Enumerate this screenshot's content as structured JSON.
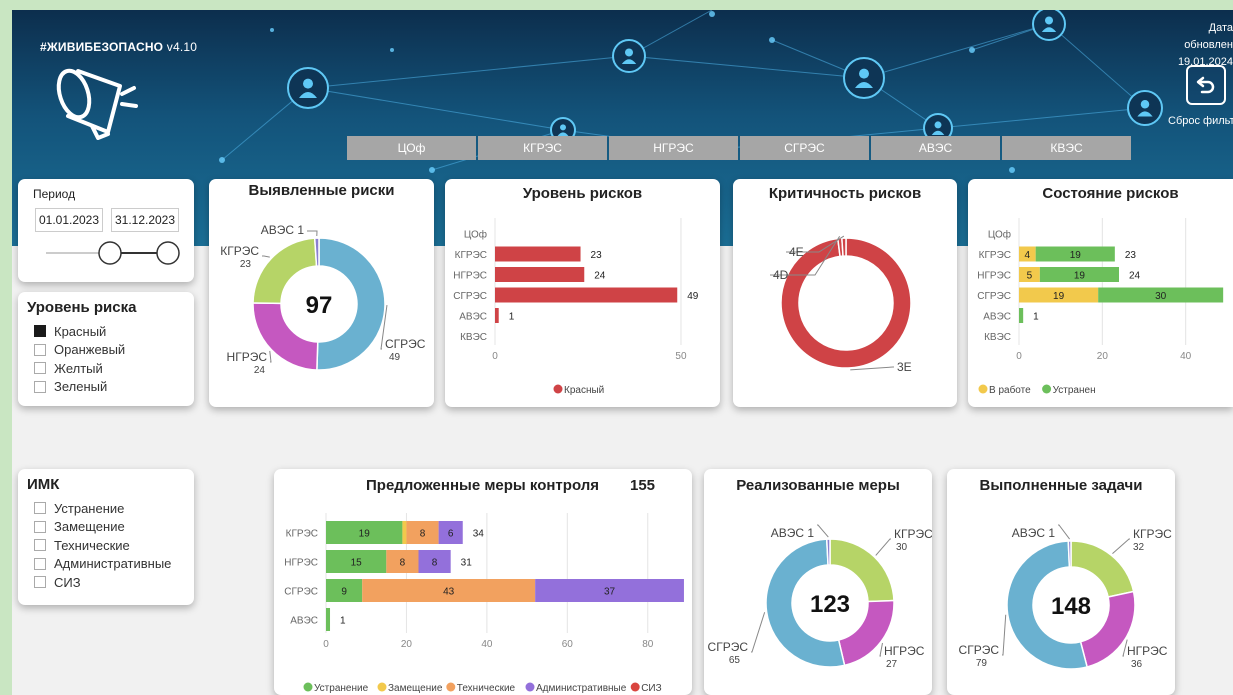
{
  "brand": {
    "name": "#ЖИВИБЕЗОПАСНО",
    "version": "v4.10"
  },
  "updated": {
    "label": "Дата обновлен",
    "date": "19.01.2024"
  },
  "reset": {
    "label": "Сброс фильтр"
  },
  "tabs": [
    "ЦОф",
    "КГРЭС",
    "НГРЭС",
    "СГРЭС",
    "АВЭС",
    "КВЭС"
  ],
  "period": {
    "label": "Период",
    "from": "01.01.2023",
    "to": "31.12.2023"
  },
  "risk_level_filter": {
    "title": "Уровень риска",
    "options": [
      {
        "label": "Красный",
        "checked": true
      },
      {
        "label": "Оранжевый",
        "checked": false
      },
      {
        "label": "Желтый",
        "checked": false
      },
      {
        "label": "Зеленый",
        "checked": false
      }
    ]
  },
  "imk_filter": {
    "title": "ИМК",
    "options": [
      {
        "label": "Устранение",
        "checked": false
      },
      {
        "label": "Замещение",
        "checked": false
      },
      {
        "label": "Технические",
        "checked": false
      },
      {
        "label": "Административные",
        "checked": false
      },
      {
        "label": "СИЗ",
        "checked": false
      }
    ]
  },
  "colors": {
    "blue": "#6ab1d0",
    "green": "#b6d467",
    "purple": "#c558c0",
    "red": "#cf4346",
    "meas_green": "#6cbf5b",
    "meas_yellow": "#f2c94c",
    "meas_orange": "#f2a15f",
    "meas_purple": "#9370db",
    "meas_red": "#d9453f"
  },
  "chart_data": [
    {
      "id": "identified",
      "type": "pie",
      "title": "Выявленные риски",
      "center_value": "97",
      "slices": [
        {
          "label": "СГРЭС",
          "value": 49,
          "color": "#6ab1d0"
        },
        {
          "label": "НГРЭС",
          "value": 24,
          "color": "#c558c0"
        },
        {
          "label": "КГРЭС",
          "value": 23,
          "color": "#b6d467"
        },
        {
          "label": "АВЭС",
          "value": 1,
          "color": "#8a7fd0"
        }
      ]
    },
    {
      "id": "risk_level",
      "type": "bar",
      "title": "Уровень рисков",
      "categories": [
        "ЦОф",
        "КГРЭС",
        "НГРЭС",
        "СГРЭС",
        "АВЭС",
        "КВЭС"
      ],
      "series": [
        {
          "name": "Красный",
          "values": [
            null,
            23,
            24,
            49,
            1,
            null
          ],
          "color": "#cf4346"
        }
      ],
      "xticks": [
        "0",
        "50"
      ],
      "xlim": [
        0,
        57
      ]
    },
    {
      "id": "criticality",
      "type": "pie",
      "title": "Критичность рисков",
      "slices": [
        {
          "label": "3E",
          "value": 97,
          "color": "#cf4346"
        },
        {
          "label": "4D",
          "value": 1,
          "color": "#cf4346"
        },
        {
          "label": "4E",
          "value": 1,
          "color": "#cf4346"
        }
      ]
    },
    {
      "id": "risk_state",
      "type": "bar",
      "title": "Состояние рисков",
      "categories": [
        "ЦОф",
        "КГРЭС",
        "НГРЭС",
        "СГРЭС",
        "АВЭС",
        "КВЭС"
      ],
      "series": [
        {
          "name": "В работе",
          "values": [
            null,
            4,
            5,
            19,
            null,
            null
          ],
          "color": "#f2c94c"
        },
        {
          "name": "Устранен",
          "values": [
            null,
            19,
            19,
            30,
            1,
            null
          ],
          "color": "#6cbf5b"
        }
      ],
      "totals": [
        null,
        23,
        24,
        49,
        null,
        null
      ],
      "xticks": [
        "0",
        "20",
        "40"
      ],
      "xlim": [
        0,
        48
      ]
    },
    {
      "id": "proposed",
      "type": "bar",
      "title": "Предложенные меры контроля",
      "total": "155",
      "categories": [
        "КГРЭС",
        "НГРЭС",
        "СГРЭС",
        "АВЭС"
      ],
      "series": [
        {
          "name": "Устранение",
          "values": [
            19,
            15,
            9,
            1
          ],
          "color": "#6cbf5b"
        },
        {
          "name": "Замещение",
          "values": [
            1,
            0,
            0,
            0
          ],
          "color": "#f2c94c"
        },
        {
          "name": "Технические",
          "values": [
            8,
            8,
            43,
            0
          ],
          "color": "#f2a15f"
        },
        {
          "name": "Административные",
          "values": [
            6,
            8,
            37,
            0
          ],
          "color": "#9370db"
        },
        {
          "name": "СИЗ",
          "values": [
            0,
            0,
            0,
            0
          ],
          "color": "#d9453f"
        }
      ],
      "totals": [
        34,
        31,
        89,
        1
      ],
      "xticks": [
        "0",
        "20",
        "40",
        "60",
        "80"
      ],
      "xlim": [
        0,
        91
      ]
    },
    {
      "id": "implemented",
      "type": "pie",
      "title": "Реализованные меры",
      "center_value": "123",
      "slices": [
        {
          "label": "КГРЭС",
          "value": 30,
          "color": "#b6d467"
        },
        {
          "label": "НГРЭС",
          "value": 27,
          "color": "#c558c0"
        },
        {
          "label": "СГРЭС",
          "value": 65,
          "color": "#6ab1d0"
        },
        {
          "label": "АВЭС",
          "value": 1,
          "color": "#8a7fd0"
        }
      ]
    },
    {
      "id": "tasks",
      "type": "pie",
      "title": "Выполненные задачи",
      "center_value": "148",
      "slices": [
        {
          "label": "КГРЭС",
          "value": 32,
          "color": "#b6d467"
        },
        {
          "label": "НГРЭС",
          "value": 36,
          "color": "#c558c0"
        },
        {
          "label": "СГРЭС",
          "value": 79,
          "color": "#6ab1d0"
        },
        {
          "label": "АВЭС",
          "value": 1,
          "color": "#8a7fd0"
        }
      ]
    }
  ]
}
